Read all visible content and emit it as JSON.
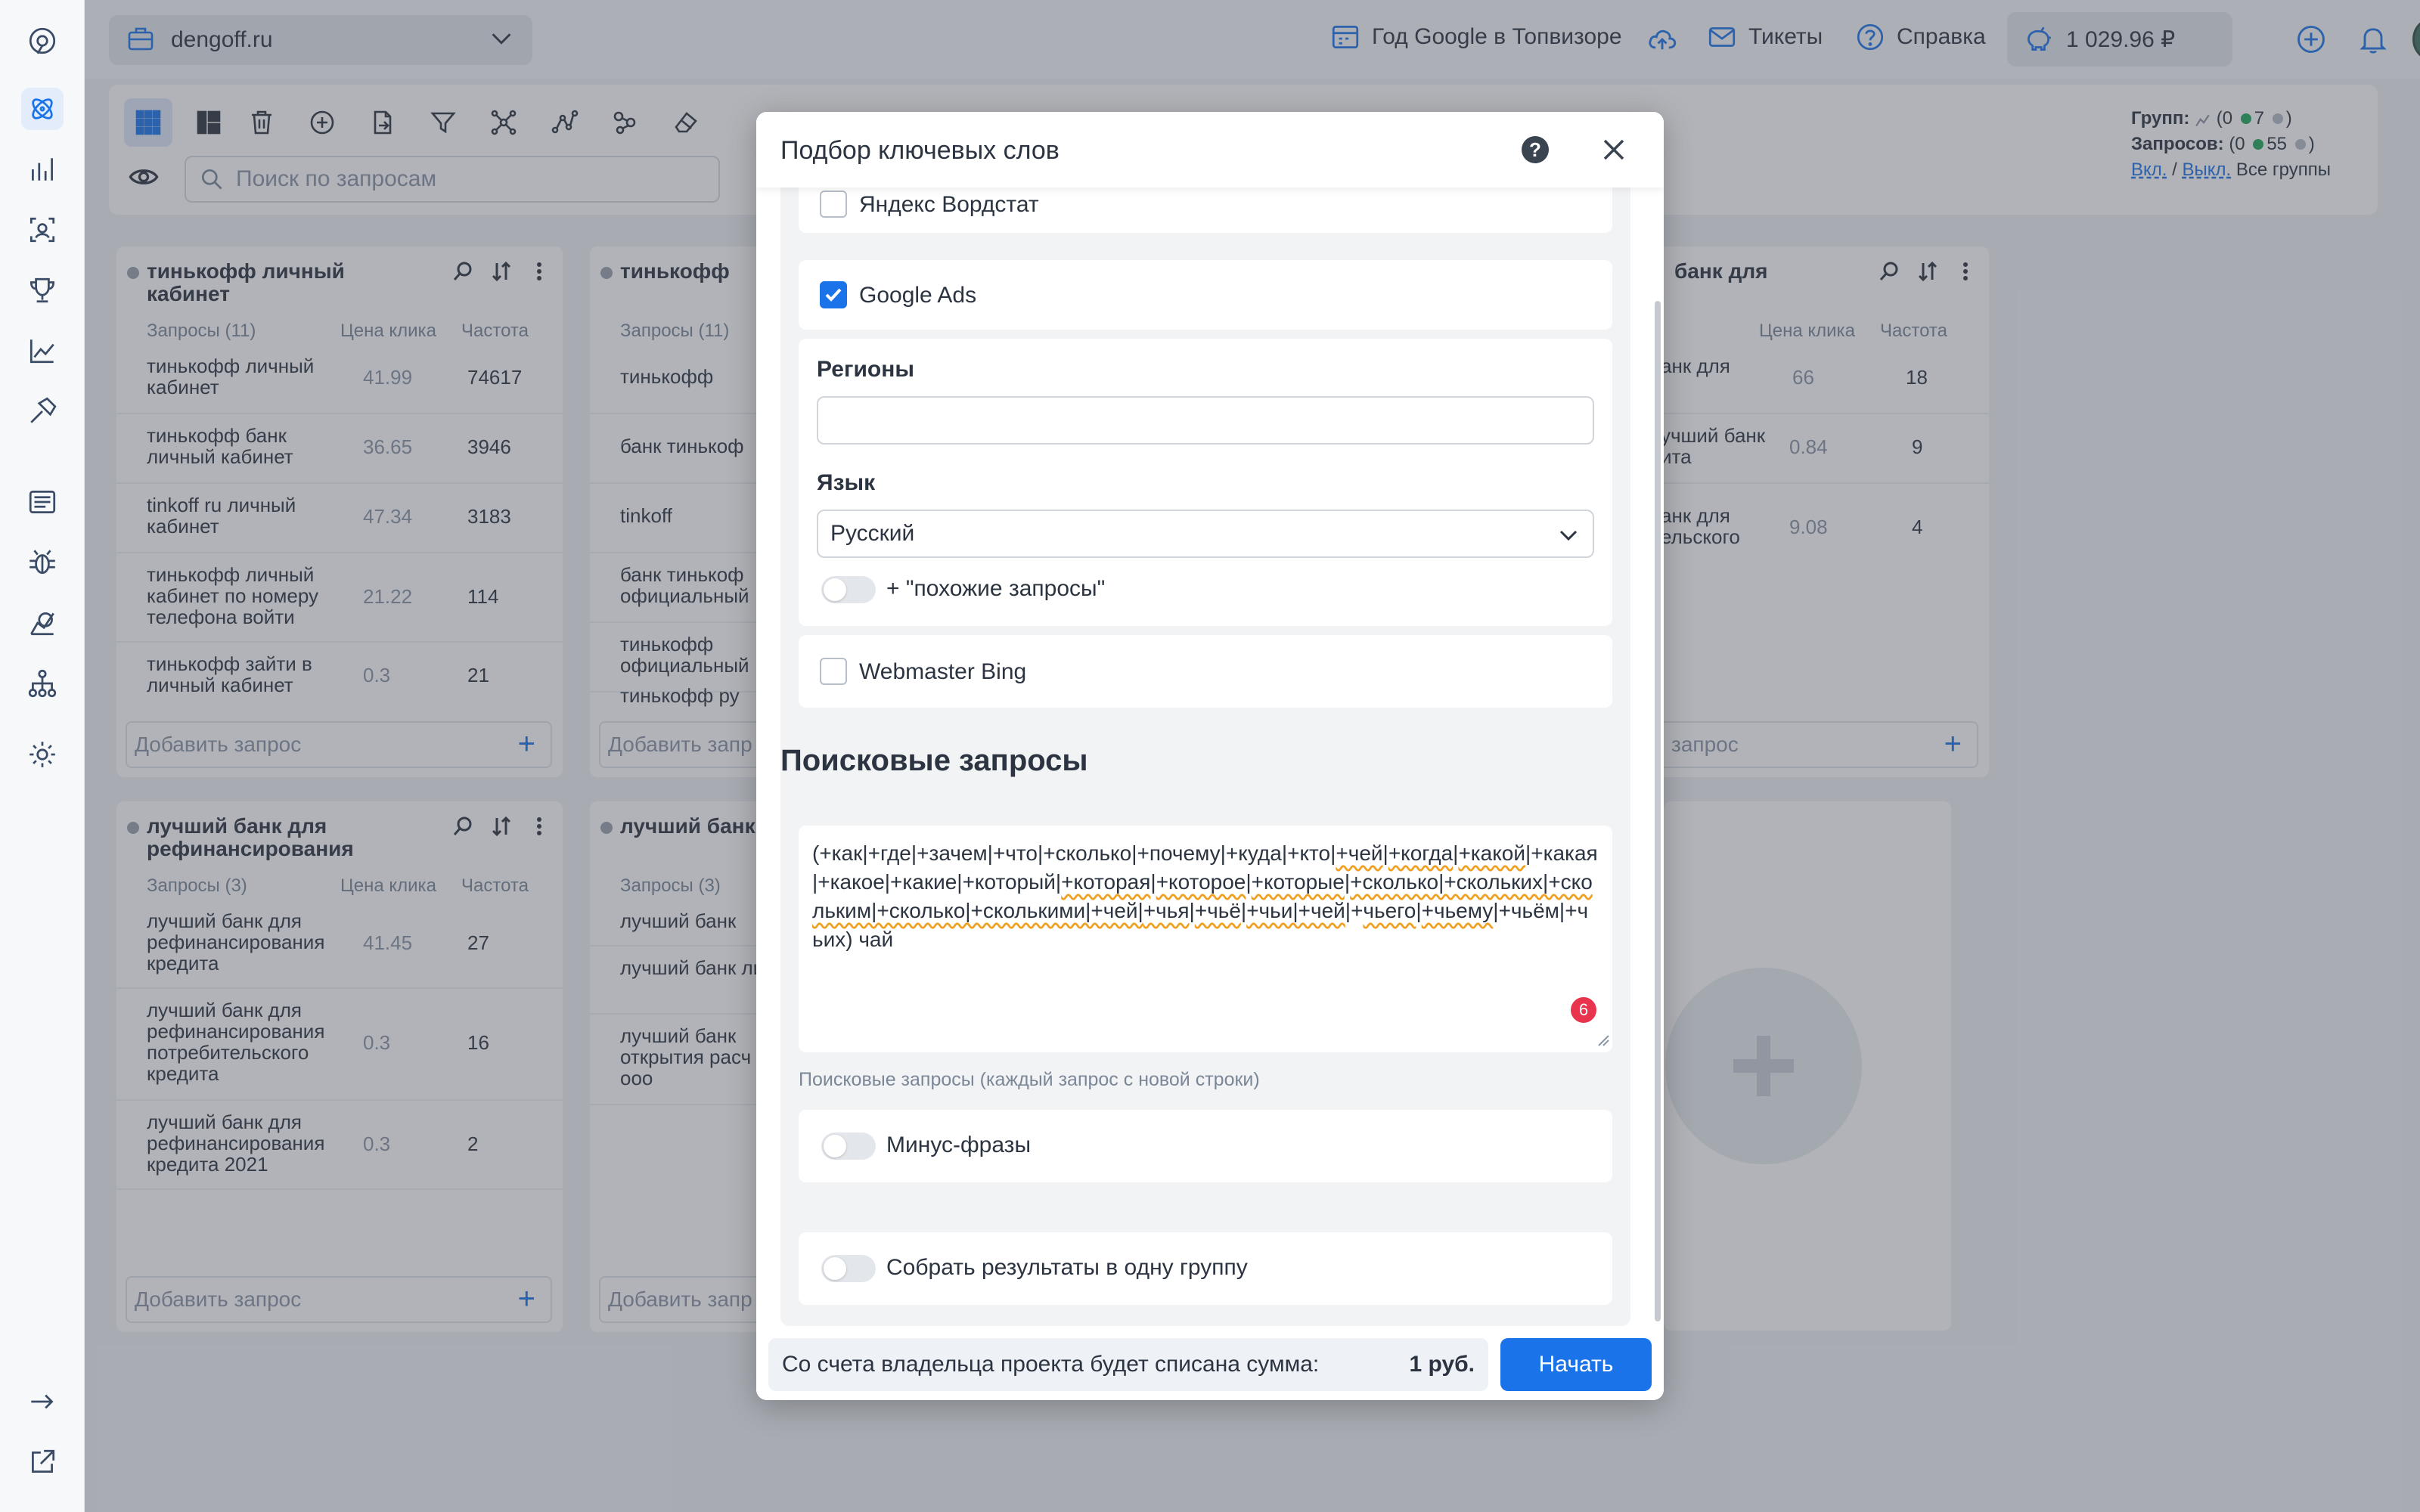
{
  "topbar": {
    "project_name": "dengoff.ru",
    "links": {
      "google_year": "Год Google в Топвизоре",
      "tickets": "Тикеты",
      "help": "Справка"
    },
    "balance": "1 029.96 ₽"
  },
  "toolbar": {
    "search_placeholder": "Поиск по запросам",
    "stats": {
      "groups_label": "Групп:",
      "groups_open": "(0",
      "groups_active": "7",
      "groups_close": ")",
      "queries_label": "Запросов:",
      "queries_open": "(0",
      "queries_active": "55",
      "queries_close": ")",
      "on_link": "Вкл.",
      "sep": "/",
      "off_link": "Выкл.",
      "all_groups": "Все группы"
    }
  },
  "cards": [
    {
      "title": "тинькофф личный кабинет",
      "col_queries": "Запросы (11)",
      "col_price": "Цена клика",
      "col_freq": "Частота",
      "rows": [
        {
          "q": "тинькофф личный кабинет",
          "price": "41.99",
          "freq": "74617"
        },
        {
          "q": "тинькофф банк личный кабинет",
          "price": "36.65",
          "freq": "3946"
        },
        {
          "q": "tinkoff ru личный кабинет",
          "price": "47.34",
          "freq": "3183"
        },
        {
          "q": "тинькофф личный кабинет по номеру телефона войти",
          "price": "21.22",
          "freq": "114"
        },
        {
          "q": "тинькофф зайти в личный кабинет",
          "price": "0.3",
          "freq": "21"
        }
      ],
      "add_placeholder": "Добавить запрос"
    },
    {
      "title": "тинькофф",
      "col_queries": "Запросы (11)",
      "rows": [
        {
          "q": "тинькофф"
        },
        {
          "q": "банк тинькоф"
        },
        {
          "q": "tinkoff"
        },
        {
          "q": "банк тинькоф официальный"
        },
        {
          "q": "тинькофф официальный"
        },
        {
          "q": "тинькофф ру"
        }
      ],
      "add_placeholder": "Добавить запр"
    },
    {
      "title": "банк для",
      "col_queries": ")",
      "col_price": "Цена клика",
      "col_freq": "Частота",
      "rows": [
        {
          "q": "анк для",
          "price": "66",
          "freq": "18"
        },
        {
          "q": "учший банк ита",
          "price": "0.84",
          "freq": "9"
        },
        {
          "q": "анк для ельского",
          "price": "9.08",
          "freq": "4"
        }
      ],
      "add_placeholder": "запрос"
    },
    {
      "title": "лучший банк для рефинансирования",
      "col_queries": "Запросы (3)",
      "col_price": "Цена клика",
      "col_freq": "Частота",
      "rows": [
        {
          "q": "лучший банк для рефинансирования кредита",
          "price": "41.45",
          "freq": "27"
        },
        {
          "q": "лучший банк для рефинансирования потребительского кредита",
          "price": "0.3",
          "freq": "16"
        },
        {
          "q": "лучший банк для рефинансирования кредита 2021",
          "price": "0.3",
          "freq": "2"
        }
      ],
      "add_placeholder": "Добавить запрос"
    },
    {
      "title": "лучший банк",
      "col_queries": "Запросы (3)",
      "rows": [
        {
          "q": "лучший банк"
        },
        {
          "q": "лучший банк лиц"
        },
        {
          "q": "лучший банк открытия расч счета ооо"
        }
      ],
      "add_placeholder": "Добавить запр"
    }
  ],
  "modal": {
    "title": "Подбор ключевых слов",
    "yandex_wordstat_label": "Яндекс Вордстат",
    "google_ads_label": "Google Ads",
    "google_ads_checked": true,
    "regions_label": "Регионы",
    "regions_value": "",
    "language_label": "Язык",
    "language_value": "Русский",
    "similar_toggle_label": "+ \"похожие запросы\"",
    "bing_label": "Webmaster Bing",
    "queries_section_title": "Поисковые запросы",
    "queries_text_parts": [
      {
        "t": "(+как|+где|+зачем|+что|+сколько|+почему|+куда|+кто|",
        "w": false
      },
      {
        "t": "+чей",
        "w": true
      },
      {
        "t": "|",
        "w": false
      },
      {
        "t": "+когда",
        "w": true
      },
      {
        "t": "|",
        "w": false
      },
      {
        "t": "+какой",
        "w": true
      },
      {
        "t": "|+какая|+какое|+какие|+который|",
        "w": false
      },
      {
        "t": "+которая",
        "w": true
      },
      {
        "t": "|",
        "w": false
      },
      {
        "t": "+которое",
        "w": true
      },
      {
        "t": "|",
        "w": false
      },
      {
        "t": "+которые",
        "w": true
      },
      {
        "t": "|",
        "w": false
      },
      {
        "t": "+сколько|+скольких|+скольким|+сколько|+сколькими|+чей|",
        "w": true
      },
      {
        "t": "+чья",
        "w": true
      },
      {
        "t": "|",
        "w": false
      },
      {
        "t": "+чьё",
        "w": true
      },
      {
        "t": "|",
        "w": false
      },
      {
        "t": "+чьи|+чей",
        "w": true
      },
      {
        "t": "|+",
        "w": false
      },
      {
        "t": "чьего",
        "w": true
      },
      {
        "t": "|",
        "w": false
      },
      {
        "t": "+чьему",
        "w": true
      },
      {
        "t": "|+чьём|+чьих) чай",
        "w": false
      }
    ],
    "spell_badge_count": "6",
    "queries_hint": "Поисковые запросы (каждый запрос с новой строки)",
    "minus_phrases_label": "Минус-фразы",
    "one_group_label": "Собрать результаты в одну группу",
    "cost_text": "Со счета владельца проекта будет списана сумма:",
    "cost_amount": "1 руб.",
    "start_button": "Начать"
  }
}
